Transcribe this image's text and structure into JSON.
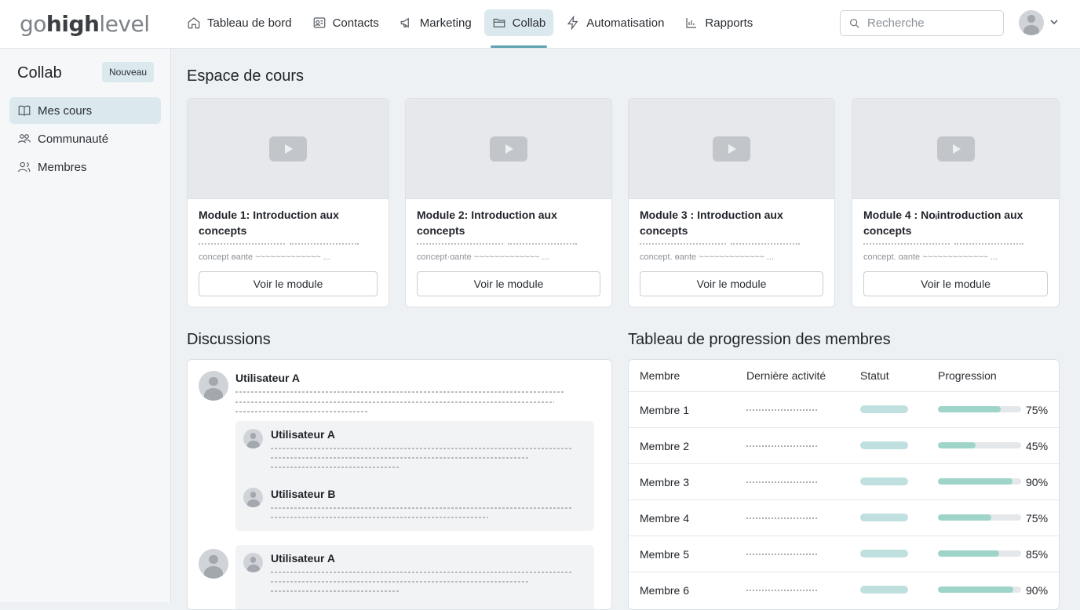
{
  "logo": {
    "part1": "go",
    "part2": "high",
    "part3": "level"
  },
  "nav": [
    {
      "label": "Tableau de bord",
      "icon": "home-icon"
    },
    {
      "label": "Contacts",
      "icon": "contact-card-icon"
    },
    {
      "label": "Marketing",
      "icon": "megaphone-icon"
    },
    {
      "label": "Collab",
      "icon": "folder-icon",
      "active": true
    },
    {
      "label": "Automatisation",
      "icon": "lightning-icon"
    },
    {
      "label": "Rapports",
      "icon": "bar-chart-icon"
    }
  ],
  "search": {
    "placeholder": "Recherche"
  },
  "sidebar": {
    "title": "Collab",
    "new_label": "Nouveau",
    "items": [
      {
        "label": "Mes cours",
        "icon": "book-icon",
        "active": true
      },
      {
        "label": "Communauté",
        "icon": "community-icon"
      },
      {
        "label": "Membres",
        "icon": "members-icon"
      }
    ]
  },
  "courses": {
    "heading": "Espace de cours",
    "cards": [
      {
        "title": "Module 1: Introduction aux concepts",
        "desc": "concept ɵante ~~~~~~~~~~~~~ ...",
        "button": "Voir le module"
      },
      {
        "title": "Module 2: Introduction aux concepts",
        "desc": "concept·ɑante ~~~~~~~~~~~~~ ...",
        "button": "Voir le module"
      },
      {
        "title": "Module 3 : Introduction aux concepts",
        "desc": "concept. ɵante ~~~~~~~~~~~~~ ...",
        "button": "Voir le module"
      },
      {
        "title": "Module 4 : Noᵢintroduction aux concepts",
        "desc": "concept. ɑante ~~~~~~~~~~~~~ ...",
        "button": "Voir le module"
      }
    ]
  },
  "discussions": {
    "heading": "Discussions",
    "thread1": {
      "author": "Utilisateur A",
      "reply1": "Utilisateur A",
      "reply2": "Utilisateur B"
    },
    "thread2": {
      "reply1": "Utilisateur A"
    }
  },
  "progress": {
    "heading": "Tableau de progression des membres",
    "columns": [
      "Membre",
      "Dernière activité",
      "Statut",
      "Progression"
    ],
    "rows": [
      {
        "name": "Membre 1",
        "progress": 0.75,
        "label": "75%"
      },
      {
        "name": "Membre 2",
        "progress": 0.45,
        "label": "45%"
      },
      {
        "name": "Membre 3",
        "progress": 0.9,
        "label": "90%"
      },
      {
        "name": "Membre 4",
        "progress": 0.64,
        "label": "75%"
      },
      {
        "name": "Membre 5",
        "progress": 0.74,
        "label": "85%"
      },
      {
        "name": "Membre 6",
        "progress": 0.91,
        "label": "90%"
      }
    ]
  }
}
